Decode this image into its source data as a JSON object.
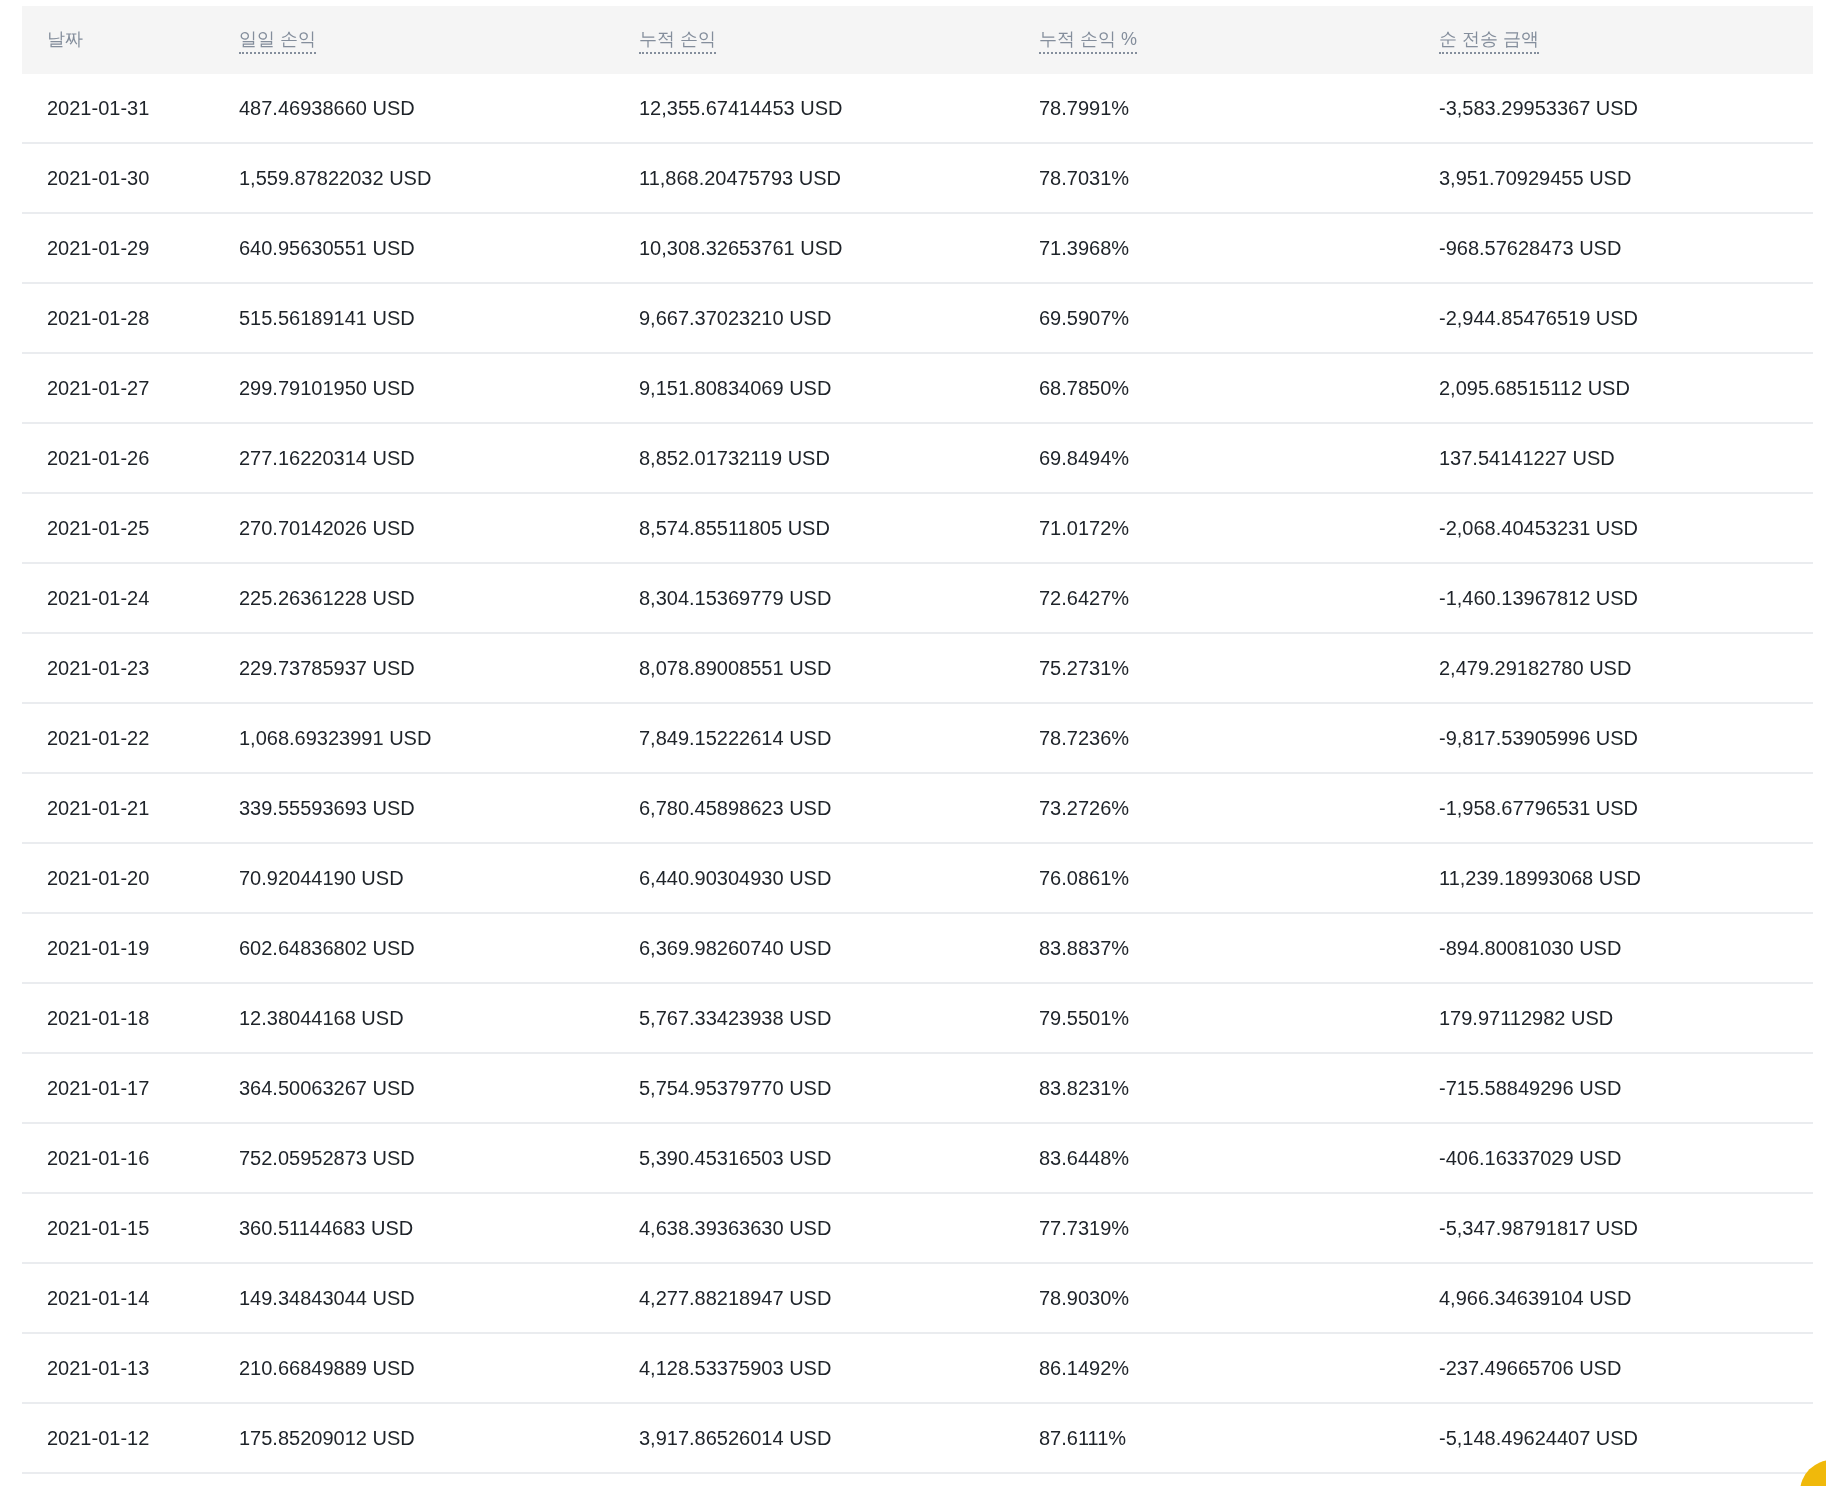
{
  "table": {
    "columns": [
      {
        "label": "날짜",
        "dotted_underline": false
      },
      {
        "label": "일일 손익",
        "dotted_underline": true
      },
      {
        "label": "누적 손익",
        "dotted_underline": true
      },
      {
        "label": "누적 손익 %",
        "dotted_underline": true
      },
      {
        "label": "순 전송 금액",
        "dotted_underline": true
      }
    ],
    "rows": [
      [
        "2021-01-31",
        "487.46938660 USD",
        "12,355.67414453 USD",
        "78.7991%",
        "-3,583.29953367 USD"
      ],
      [
        "2021-01-30",
        "1,559.87822032 USD",
        "11,868.20475793 USD",
        "78.7031%",
        "3,951.70929455 USD"
      ],
      [
        "2021-01-29",
        "640.95630551 USD",
        "10,308.32653761 USD",
        "71.3968%",
        "-968.57628473 USD"
      ],
      [
        "2021-01-28",
        "515.56189141 USD",
        "9,667.37023210 USD",
        "69.5907%",
        "-2,944.85476519 USD"
      ],
      [
        "2021-01-27",
        "299.79101950 USD",
        "9,151.80834069 USD",
        "68.7850%",
        "2,095.68515112 USD"
      ],
      [
        "2021-01-26",
        "277.16220314 USD",
        "8,852.01732119 USD",
        "69.8494%",
        "137.54141227 USD"
      ],
      [
        "2021-01-25",
        "270.70142026 USD",
        "8,574.85511805 USD",
        "71.0172%",
        "-2,068.40453231 USD"
      ],
      [
        "2021-01-24",
        "225.26361228 USD",
        "8,304.15369779 USD",
        "72.6427%",
        "-1,460.13967812 USD"
      ],
      [
        "2021-01-23",
        "229.73785937 USD",
        "8,078.89008551 USD",
        "75.2731%",
        "2,479.29182780 USD"
      ],
      [
        "2021-01-22",
        "1,068.69323991 USD",
        "7,849.15222614 USD",
        "78.7236%",
        "-9,817.53905996 USD"
      ],
      [
        "2021-01-21",
        "339.55593693 USD",
        "6,780.45898623 USD",
        "73.2726%",
        "-1,958.67796531 USD"
      ],
      [
        "2021-01-20",
        "70.92044190 USD",
        "6,440.90304930 USD",
        "76.0861%",
        "11,239.18993068 USD"
      ],
      [
        "2021-01-19",
        "602.64836802 USD",
        "6,369.98260740 USD",
        "83.8837%",
        "-894.80081030 USD"
      ],
      [
        "2021-01-18",
        "12.38044168 USD",
        "5,767.33423938 USD",
        "79.5501%",
        "179.97112982 USD"
      ],
      [
        "2021-01-17",
        "364.50063267 USD",
        "5,754.95379770 USD",
        "83.8231%",
        "-715.58849296 USD"
      ],
      [
        "2021-01-16",
        "752.05952873 USD",
        "5,390.45316503 USD",
        "83.6448%",
        "-406.16337029 USD"
      ],
      [
        "2021-01-15",
        "360.51144683 USD",
        "4,638.39363630 USD",
        "77.7319%",
        "-5,347.98791817 USD"
      ],
      [
        "2021-01-14",
        "149.34843044 USD",
        "4,277.88218947 USD",
        "78.9030%",
        "4,966.34639104 USD"
      ],
      [
        "2021-01-13",
        "210.66849889 USD",
        "4,128.53375903 USD",
        "86.1492%",
        "-237.49665706 USD"
      ],
      [
        "2021-01-12",
        "175.85209012 USD",
        "3,917.86526014 USD",
        "87.6111%",
        "-5,148.49624407 USD"
      ]
    ]
  }
}
